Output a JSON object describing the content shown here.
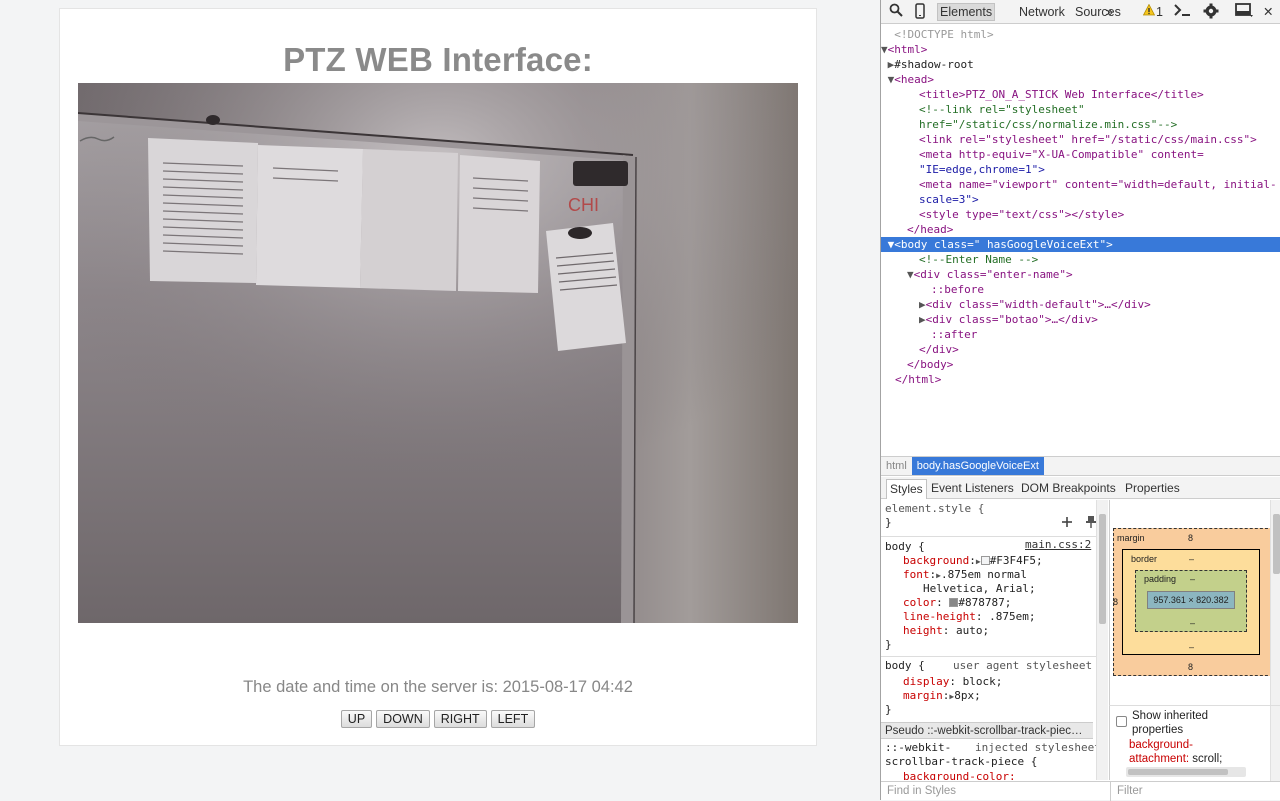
{
  "page": {
    "title": "PTZ WEB Interface:",
    "datetime_text": "The date and time on the server is: 2015-08-17 04:42",
    "buttons": [
      "UP",
      "DOWN",
      "RIGHT",
      "LEFT"
    ],
    "camera_feed_label": "Camera feed of whiteboard",
    "whiteboard_note": "CHI"
  },
  "devtools": {
    "tabs": [
      "Elements",
      "Network",
      "Sources"
    ],
    "more": "»",
    "warnings_count": "1",
    "close": "✕",
    "tree": [
      "<!DOCTYPE html>",
      "<html>",
      "#shadow-root",
      "<head>",
      "<title>PTZ_ON_A_STICK Web Interface</title>",
      "<!--link rel=\"stylesheet\"",
      "href=\"/static/css/normalize.min.css\"-->",
      "<link rel=\"stylesheet\" href=\"/static/css/main.css\">",
      "<meta http-equiv=\"X-UA-Compatible\" content=",
      "\"IE=edge,chrome=1\">",
      "<meta name=\"viewport\" content=\"width=default, initial-",
      "scale=3\">",
      "<style type=\"text/css\"></style>",
      "</head>",
      "<body class=\" hasGoogleVoiceExt\">",
      "<!--Enter Name -->",
      "<div class=\"enter-name\">",
      "::before",
      "<div class=\"width-default\">…</div>",
      "<div class=\"botao\">…</div>",
      "::after",
      "</div>",
      "</body>",
      "</html>"
    ],
    "breadcrumbs": [
      "html",
      "body.hasGoogleVoiceExt"
    ],
    "style_tabs": [
      "Styles",
      "Event Listeners",
      "DOM Breakpoints",
      "Properties"
    ],
    "styles": {
      "element_style": "element.style {",
      "close_brace": "}",
      "body_selector": "body {",
      "source": "main.css:2",
      "props": [
        {
          "name": "background",
          "value": "#F3F4F5;",
          "swatch": "#F3F4F5"
        },
        {
          "name": "font",
          "value": ".875em normal",
          "cont": "Helvetica, Arial;"
        },
        {
          "name": "color",
          "value": "#878787;",
          "swatch": "#878787"
        },
        {
          "name": "line-height",
          "value": ".875em;"
        },
        {
          "name": "height",
          "value": "auto;"
        }
      ],
      "ua_selector": "body {",
      "ua_label": "user agent stylesheet",
      "ua_props": [
        {
          "name": "display",
          "value": "block;"
        },
        {
          "name": "margin",
          "value": "8px;"
        }
      ],
      "pseudo_header": "Pseudo ::-webkit-scrollbar-track-piec…",
      "injected_selector": "::-webkit-",
      "injected_label": "injected stylesheet",
      "injected_selector2": "scrollbar-track-piece {",
      "injected_prop": "background-color:"
    },
    "box_model": {
      "margin_label": "margin",
      "border_label": "border",
      "padding_label": "padding",
      "margin_value": "8",
      "border_value": "–",
      "padding_value": "–",
      "content_size": "957.361 × 820.382"
    },
    "show_inherited": "Show inherited properties",
    "inherited_prop": "background-",
    "inherited_prop2": "attachment:",
    "inherited_value": "scroll;",
    "find_placeholder": "Find in Styles",
    "filter_placeholder": "Filter"
  }
}
